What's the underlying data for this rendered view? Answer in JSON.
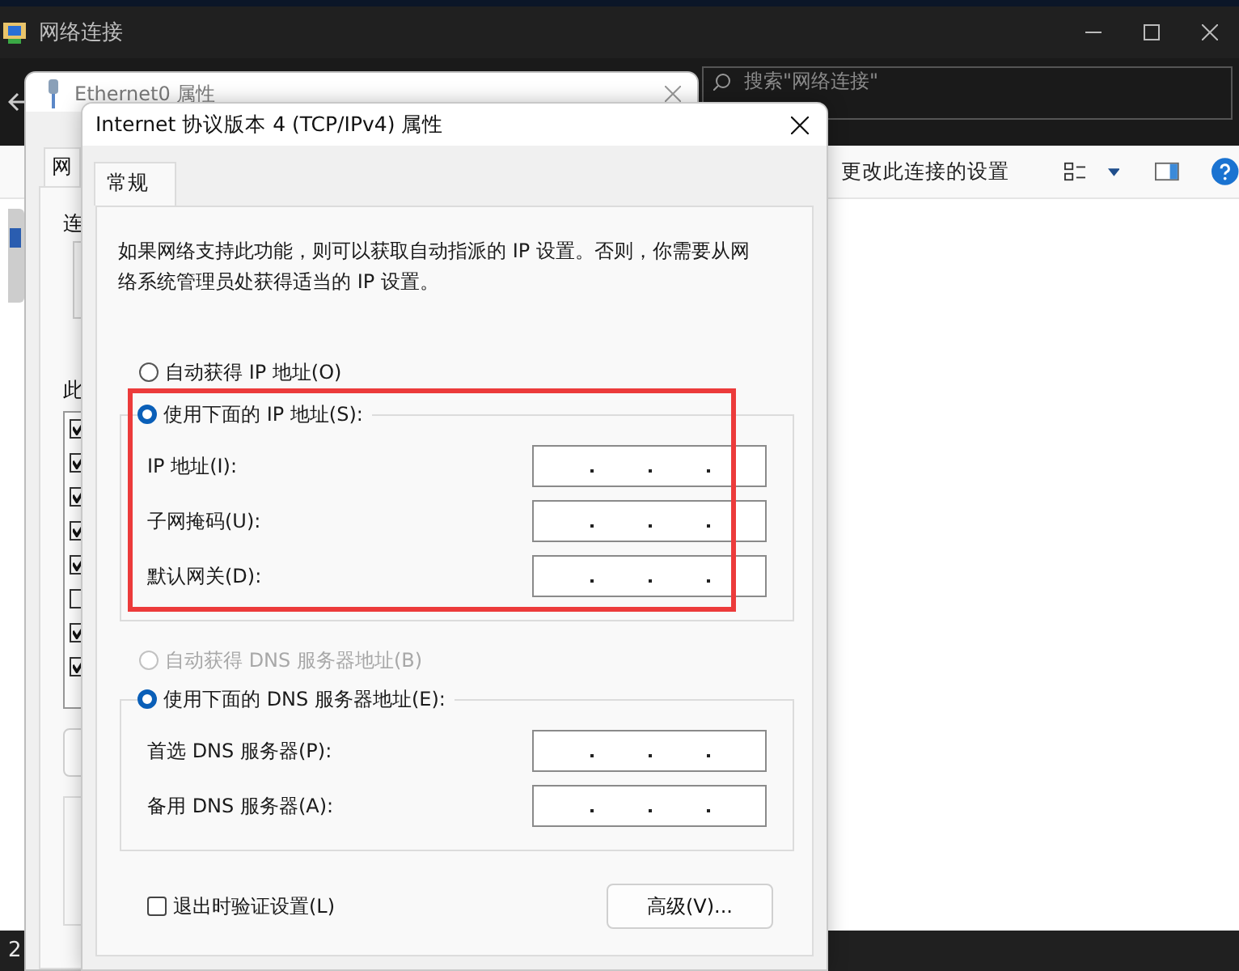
{
  "explorer": {
    "title": "网络连接",
    "search": {
      "placeholder": "搜索\"网络连接\""
    },
    "toolbar": {
      "action": "更改此连接的设置"
    },
    "status_bar": "2"
  },
  "ethernet_dialog": {
    "title": "Ethernet0 属性",
    "tabs": [
      {
        "label": "网",
        "selected": true
      }
    ],
    "connect_label": "连",
    "items_label": "此",
    "components": [
      {
        "checked": true
      },
      {
        "checked": true
      },
      {
        "checked": true
      },
      {
        "checked": true
      },
      {
        "checked": true
      },
      {
        "checked": false
      },
      {
        "checked": true
      },
      {
        "checked": true
      }
    ]
  },
  "ipv4_dialog": {
    "title": "Internet 协议版本 4 (TCP/IPv4) 属性",
    "tabs": [
      {
        "label": "常规",
        "selected": true
      }
    ],
    "description": "如果网络支持此功能，则可以获取自动指派的 IP 设置。否则，你需要从网络系统管理员处获得适当的 IP 设置。",
    "ip_options": [
      {
        "label": "自动获得 IP 地址(O)",
        "selected": false,
        "disabled": false
      },
      {
        "label": "使用下面的 IP 地址(S):",
        "selected": true,
        "disabled": false
      }
    ],
    "ip_fields": [
      {
        "label": "IP 地址(I):"
      },
      {
        "label": "子网掩码(U):"
      },
      {
        "label": "默认网关(D):"
      }
    ],
    "dns_options": [
      {
        "label": "自动获得 DNS 服务器地址(B)",
        "selected": false,
        "disabled": true
      },
      {
        "label": "使用下面的 DNS 服务器地址(E):",
        "selected": true,
        "disabled": false
      }
    ],
    "dns_fields": [
      {
        "label": "首选 DNS 服务器(P):"
      },
      {
        "label": "备用 DNS 服务器(A):"
      }
    ],
    "validate_on_exit": {
      "label": "退出时验证设置(L)",
      "checked": false
    },
    "advanced_button": "高级(V)..."
  }
}
